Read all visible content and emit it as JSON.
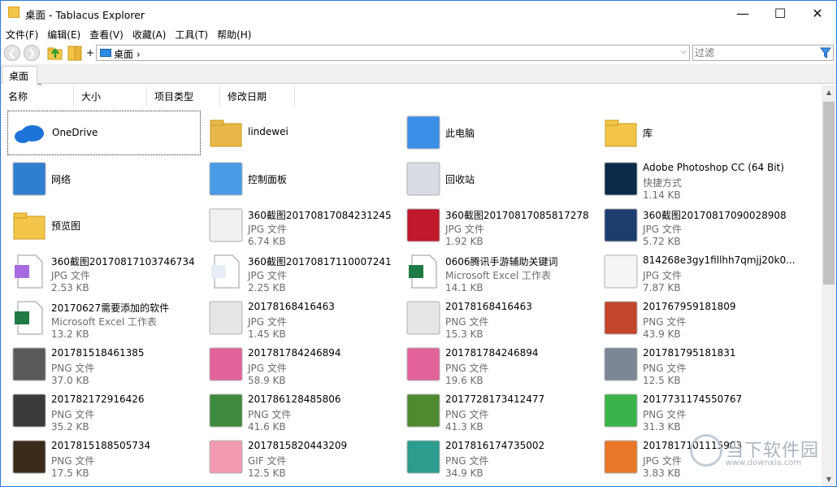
{
  "window": {
    "title": "桌面 - Tablacus Explorer",
    "min": "—",
    "max": "☐",
    "close": "✕"
  },
  "menu": [
    "文件(F)",
    "编辑(E)",
    "查看(V)",
    "收藏(A)",
    "工具(T)",
    "帮助(H)"
  ],
  "toolbar": {
    "back": "❮",
    "forward": "❯",
    "plus": "+",
    "address": "桌面 ›",
    "address_dropdown": "⌵",
    "filter_placeholder": "过滤"
  },
  "tabs": [
    {
      "label": "桌面"
    }
  ],
  "columns": [
    "名称",
    "大小",
    "项目类型",
    "修改日期"
  ],
  "sort_caret": "^",
  "scroll": {
    "up": "▲",
    "down": "▼"
  },
  "items": [
    {
      "name": "OneDrive",
      "icon": "onedrive-icon",
      "selected": true
    },
    {
      "name": "lindewei",
      "icon": "user-folder-icon"
    },
    {
      "name": "此电脑",
      "icon": "computer-icon"
    },
    {
      "name": "库",
      "icon": "library-icon"
    },
    {
      "name": "网络",
      "icon": "network-icon"
    },
    {
      "name": "控制面板",
      "icon": "control-panel-icon"
    },
    {
      "name": "回收站",
      "icon": "recycle-bin-icon"
    },
    {
      "name": "Adobe Photoshop CC (64 Bit)",
      "type": "快捷方式",
      "size": "1.14 KB",
      "icon": "photoshop-icon"
    },
    {
      "name": "预览图",
      "icon": "folder-icon"
    },
    {
      "name": "360截图20170817084231245",
      "type": "JPG 文件",
      "size": "6.74 KB",
      "icon": "text-image-icon"
    },
    {
      "name": "360截图20170817085817278",
      "type": "JPG 文件",
      "size": "1.92 KB",
      "icon": "red-apple-image-icon"
    },
    {
      "name": "360截图20170817090028908",
      "type": "JPG 文件",
      "size": "5.72 KB",
      "icon": "windows-screenshot-icon"
    },
    {
      "name": "360截图20170817103746734",
      "type": "JPG 文件",
      "size": "2.53 KB",
      "icon": "aep-file-icon"
    },
    {
      "name": "360截图20170817110007241",
      "type": "JPG 文件",
      "size": "2.25 KB",
      "icon": "document-image-icon"
    },
    {
      "name": "0606腾讯手游辅助关键词",
      "type": "Microsoft Excel 工作表",
      "size": "14.1 KB",
      "icon": "excel-icon"
    },
    {
      "name": "814268e3gy1fillhh7qmjj20k0...",
      "type": "JPG 文件",
      "size": "7.87 KB",
      "icon": "meme-image-icon"
    },
    {
      "name": "20170627需要添加的软件",
      "type": "Microsoft Excel 工作表",
      "size": "13.2 KB",
      "icon": "excel-icon"
    },
    {
      "name": "20178168416463",
      "type": "JPG 文件",
      "size": "1.45 KB",
      "icon": "grey-logo-image-icon"
    },
    {
      "name": "20178168416463",
      "type": "PNG 文件",
      "size": "15.3 KB",
      "icon": "grey-logo-image-icon"
    },
    {
      "name": "201767959181809",
      "type": "PNG 文件",
      "size": "43.9 KB",
      "icon": "game-poster-icon"
    },
    {
      "name": "201781518461385",
      "type": "PNG 文件",
      "size": "37.0 KB",
      "icon": "armor-image-icon"
    },
    {
      "name": "201781784246894",
      "type": "JPG 文件",
      "size": "58.9 KB",
      "icon": "pink-mascot-icon"
    },
    {
      "name": "201781784246894",
      "type": "PNG 文件",
      "size": "19.6 KB",
      "icon": "pink-mascot-icon"
    },
    {
      "name": "201781795181831",
      "type": "PNG 文件",
      "size": "12.5 KB",
      "icon": "key-icon"
    },
    {
      "name": "201782172916426",
      "type": "PNG 文件",
      "size": "35.2 KB",
      "icon": "dont-starve-icon"
    },
    {
      "name": "201786128485806",
      "type": "PNG 文件",
      "size": "41.6 KB",
      "icon": "sims4-icon"
    },
    {
      "name": "2017728173412477",
      "type": "PNG 文件",
      "size": "41.3 KB",
      "icon": "minecraft-icon"
    },
    {
      "name": "2017731174550767",
      "type": "PNG 文件",
      "size": "31.3 KB",
      "icon": "sims4-plumbob-icon"
    },
    {
      "name": "201781518850573​4",
      "type": "PNG 文件",
      "size": "17.5 KB",
      "icon": "300-heroes-icon"
    },
    {
      "name": "2017815820443209",
      "type": "GIF 文件",
      "size": "12.5 KB",
      "icon": "anime-girl-icon"
    },
    {
      "name": "2017816174735002",
      "type": "PNG 文件",
      "size": "34.9 KB",
      "icon": "landscape-image-icon"
    },
    {
      "name": "2017817101115903",
      "type": "JPG 文件",
      "size": "3.83 KB",
      "icon": "fire-logo-icon"
    }
  ],
  "watermark": {
    "text": "当下软件园",
    "url": "www.downxia.com"
  }
}
